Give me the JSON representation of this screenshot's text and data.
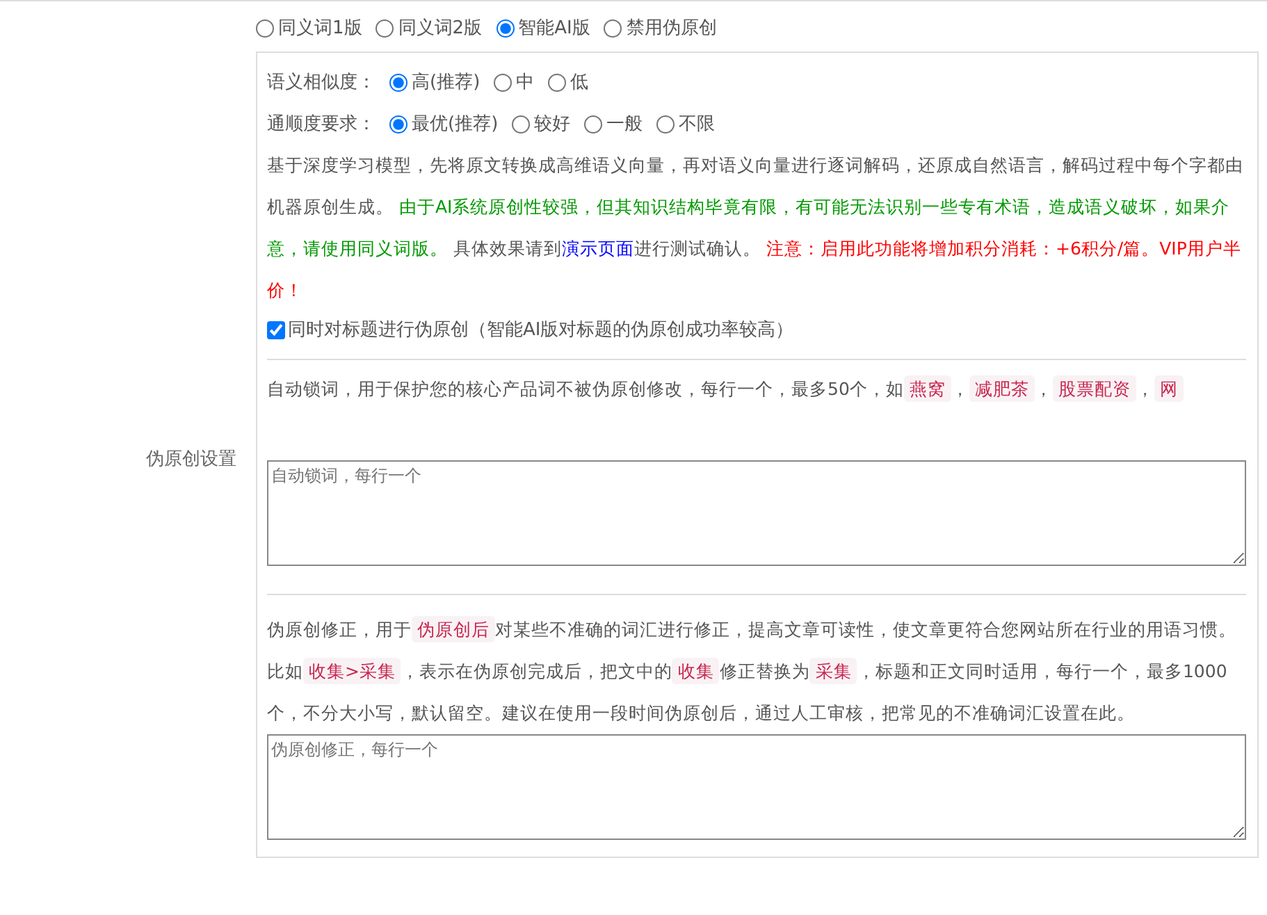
{
  "label": "伪原创设置",
  "modes": [
    {
      "label": "同义词1版",
      "selected": false
    },
    {
      "label": "同义词2版",
      "selected": false
    },
    {
      "label": "智能AI版",
      "selected": true
    },
    {
      "label": "禁用伪原创",
      "selected": false
    }
  ],
  "similarity": {
    "label": "语义相似度：",
    "options": [
      {
        "label": "高(推荐)",
        "selected": true
      },
      {
        "label": "中",
        "selected": false
      },
      {
        "label": "低",
        "selected": false
      }
    ]
  },
  "fluency": {
    "label": "通顺度要求：",
    "options": [
      {
        "label": "最优(推荐)",
        "selected": true
      },
      {
        "label": "较好",
        "selected": false
      },
      {
        "label": "一般",
        "selected": false
      },
      {
        "label": "不限",
        "selected": false
      }
    ]
  },
  "description": [
    {
      "kind": "plain",
      "text": "基于深度学习模型，先将原文转换成高维语义向量，再对语义向量进行逐词解码，还原成自然语言，解码过程中每个字都由机器原创生成。 "
    },
    {
      "kind": "green",
      "text": "由于AI系统原创性较强，但其知识结构毕竟有限，有可能无法识别一些专有术语，造成语义破坏，如果介意，请使用同义词版。"
    },
    {
      "kind": "plain",
      "text": " 具体效果请到"
    },
    {
      "kind": "link",
      "text": "演示页面"
    },
    {
      "kind": "plain",
      "text": "进行测试确认。 "
    },
    {
      "kind": "red",
      "text": "注意：启用此功能将增加积分消耗：+6积分/篇。VIP用户半价！"
    }
  ],
  "title_option": {
    "label": "同时对标题进行伪原创（智能AI版对标题的伪原创成功率较高）",
    "checked": true
  },
  "lock_words": {
    "description": [
      {
        "kind": "plain",
        "text": "自动锁词，用于保护您的核心产品词不被伪原创修改，每行一个，最多50个，如"
      },
      {
        "kind": "code",
        "text": "燕窝"
      },
      {
        "kind": "plain",
        "text": "，"
      },
      {
        "kind": "code",
        "text": "减肥茶"
      },
      {
        "kind": "plain",
        "text": "，"
      },
      {
        "kind": "code",
        "text": "股票配资"
      },
      {
        "kind": "plain",
        "text": "，"
      },
      {
        "kind": "code",
        "text": "网"
      }
    ],
    "placeholder": "自动锁词，每行一个"
  },
  "corrections": {
    "description": [
      {
        "kind": "plain",
        "text": "伪原创修正，用于"
      },
      {
        "kind": "code",
        "text": "伪原创后"
      },
      {
        "kind": "plain",
        "text": "对某些不准确的词汇进行修正，提高文章可读性，使文章更符合您网站所在行业的用语习惯。比如"
      },
      {
        "kind": "code",
        "text": "收集>采集"
      },
      {
        "kind": "plain",
        "text": "，表示在伪原创完成后，把文中的"
      },
      {
        "kind": "code",
        "text": "收集"
      },
      {
        "kind": "plain",
        "text": "修正替换为"
      },
      {
        "kind": "code",
        "text": "采集"
      },
      {
        "kind": "plain",
        "text": "，标题和正文同时适用，每行一个，最多1000个，不分大小写，默认留空。建议在使用一段时间伪原创后，通过人工审核，把常见的不准确词汇设置在此。"
      }
    ],
    "placeholder": "伪原创修正，每行一个"
  }
}
